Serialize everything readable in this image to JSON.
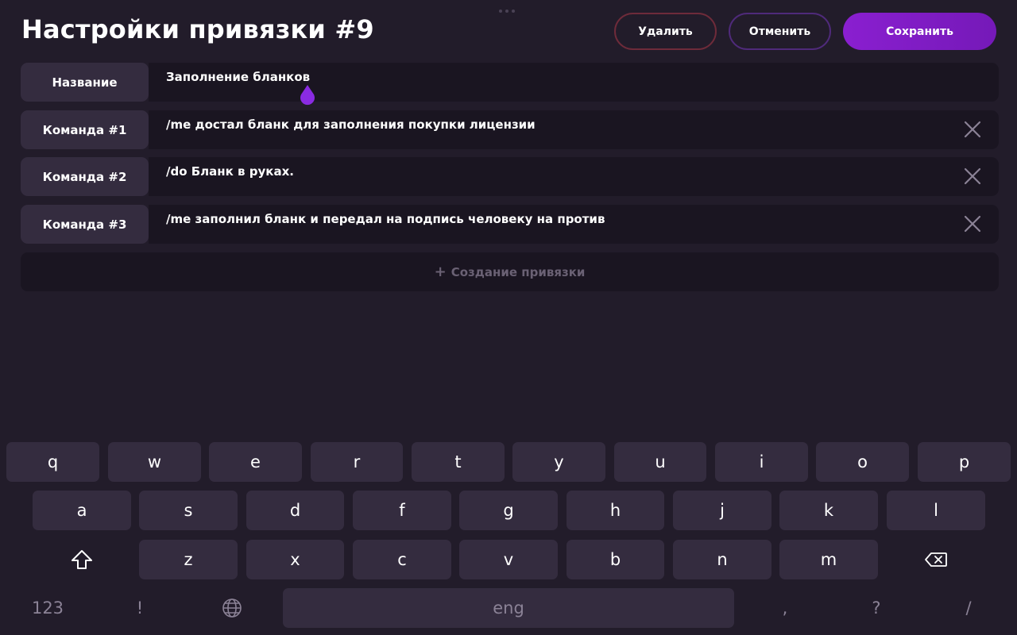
{
  "header": {
    "title": "Настройки привязки #9",
    "delete_label": "Удалить",
    "cancel_label": "Отменить",
    "save_label": "Сохранить"
  },
  "rows": [
    {
      "label": "Название",
      "value": "Заполнение бланков",
      "removable": false
    },
    {
      "label": "Команда #1",
      "value": "/me достал бланк для заполнения покупки лицензии",
      "removable": true
    },
    {
      "label": "Команда #2",
      "value": "/do Бланк в руках.",
      "removable": true
    },
    {
      "label": "Команда #3",
      "value": "/me заполнил бланк и передал на подпись человеку на против",
      "removable": true
    }
  ],
  "create_label": "Создание привязки",
  "keyboard": {
    "row1": [
      "q",
      "w",
      "e",
      "r",
      "t",
      "y",
      "u",
      "i",
      "o",
      "p"
    ],
    "row2": [
      "a",
      "s",
      "d",
      "f",
      "g",
      "h",
      "j",
      "k",
      "l"
    ],
    "row3": [
      "z",
      "x",
      "c",
      "v",
      "b",
      "n",
      "m"
    ],
    "bottom": {
      "numbers": "123",
      "exclam": "!",
      "space": "eng",
      "comma": ",",
      "question": "?",
      "slash": "/"
    },
    "icons": {
      "shift": "shift-icon",
      "backspace": "backspace-icon",
      "globe": "globe-icon"
    }
  },
  "colors": {
    "background": "#221c2a",
    "accent": "#8a1fd0",
    "delete_border": "#6e2b3a",
    "cancel_border": "#4f2a7a",
    "key_bg": "#342c3f"
  }
}
